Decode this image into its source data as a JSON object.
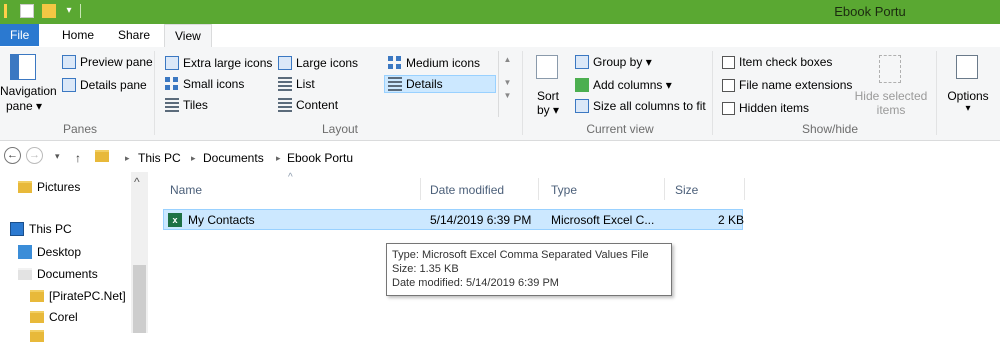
{
  "window": {
    "title": "Ebook Portu",
    "accent_color": "#5aa832",
    "file_tab_color": "#2b79d0"
  },
  "tabs": [
    {
      "label": "File"
    },
    {
      "label": "Home"
    },
    {
      "label": "Share"
    },
    {
      "label": "View"
    }
  ],
  "ribbon": {
    "panes": {
      "navigation_pane_label_line1": "Navigation",
      "navigation_pane_label_line2": "pane ▾",
      "preview_pane": "Preview pane",
      "details_pane": "Details pane",
      "group_label": "Panes"
    },
    "layout": {
      "items": [
        "Extra large icons",
        "Large icons",
        "Medium icons",
        "Small icons",
        "List",
        "Details",
        "Tiles",
        "Content"
      ],
      "selected": "Details",
      "group_label": "Layout"
    },
    "current_view": {
      "sort_by_line1": "Sort",
      "sort_by_line2": "by ▾",
      "group_by": "Group by ▾",
      "add_columns": "Add columns ▾",
      "size_columns": "Size all columns to fit",
      "group_label": "Current view"
    },
    "show_hide": {
      "item_check_boxes": "Item check boxes",
      "file_name_extensions": "File name extensions",
      "hidden_items": "Hidden items",
      "hide_selected_line1": "Hide selected",
      "hide_selected_line2": "items",
      "group_label": "Show/hide"
    },
    "options": {
      "label": "Options",
      "arrow": "▾"
    }
  },
  "address": {
    "back": "←",
    "forward": "→",
    "recent": "▾",
    "up": "↑",
    "breadcrumbs": [
      "This PC",
      "Documents",
      "Ebook Portu"
    ],
    "separator": "▸"
  },
  "nav_pane": {
    "items": [
      "Pictures",
      "This PC",
      "Desktop",
      "Documents",
      "[PiratePC.Net]",
      "Corel"
    ],
    "collapse_arrow": "^"
  },
  "file_list": {
    "columns": [
      "Name",
      "Date modified",
      "Type",
      "Size"
    ],
    "sort_arrow": "^",
    "rows": [
      {
        "name": "My Contacts",
        "date_modified": "5/14/2019 6:39 PM",
        "type": "Microsoft Excel C...",
        "size": "2 KB"
      }
    ]
  },
  "tooltip": {
    "line1": "Type: Microsoft Excel Comma Separated Values File",
    "line2": "Size: 1.35 KB",
    "line3": "Date modified: 5/14/2019 6:39 PM"
  },
  "icons": {
    "excel": "x"
  }
}
